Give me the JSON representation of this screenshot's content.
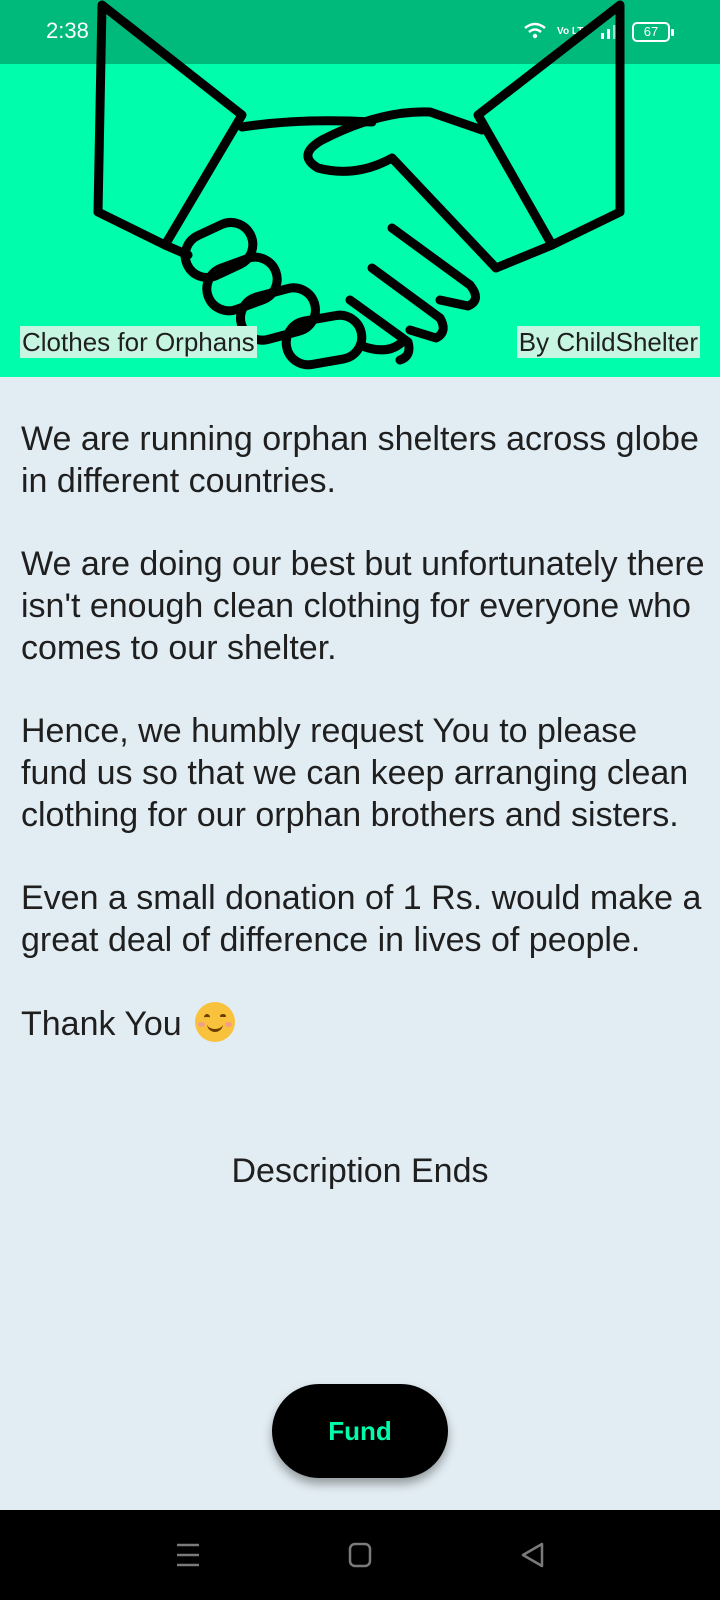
{
  "status_bar": {
    "time": "2:38",
    "network_label": "Vo LTE",
    "battery_level": "67",
    "icons": [
      "wifi-icon",
      "volte-icon",
      "signal-icon",
      "battery-icon"
    ]
  },
  "banner": {
    "image": "handshake-icon",
    "title": "Clothes for Orphans",
    "organizer": "By ChildShelter",
    "background_color": "#00fdab"
  },
  "description": {
    "paragraphs": [
      "We are running orphan shelters across globe in different countries.",
      "We are doing our best but unfortunately there isn't enough clean clothing for everyone who comes to our shelter.",
      "Hence, we humbly request You to please fund us so that we can keep arranging clean clothing for our orphan brothers and sisters.",
      "Even a small donation of 1 Rs. would make a great deal of difference in lives of people."
    ],
    "thanks": "Thank You",
    "thanks_emoji": "smiling-face-icon",
    "end_label": "Description Ends"
  },
  "fund_button": {
    "label": "Fund",
    "text_color": "#00fdab",
    "background_color": "#000000"
  },
  "nav_bar": {
    "buttons": [
      "menu-icon",
      "home-square-icon",
      "back-triangle-icon"
    ]
  },
  "colors": {
    "status_bar": "#00ba7c",
    "page_background": "#e2edf3"
  }
}
